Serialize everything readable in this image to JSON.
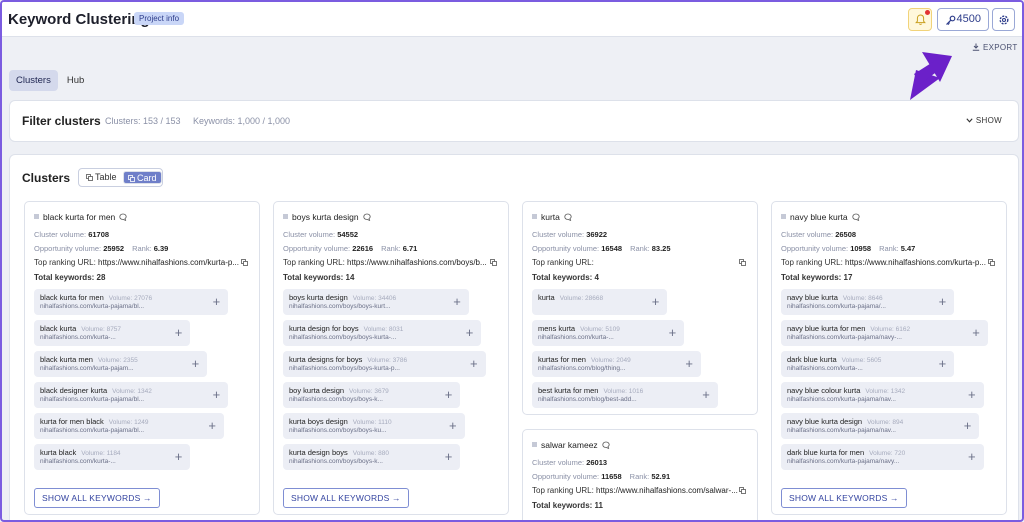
{
  "header": {
    "title": "Keyword Clustering",
    "badge": "Project info",
    "credits": "4500",
    "colors": {
      "accent": "#6f7fc9",
      "arrow": "#6b20c9",
      "border": "#7b5ce0"
    }
  },
  "toolbar": {
    "export_label": "EXPORT"
  },
  "tabs": [
    {
      "label": "Clusters",
      "active": true
    },
    {
      "label": "Hub",
      "active": false
    }
  ],
  "filter": {
    "title": "Filter clusters",
    "clusters_stat": "Clusters: 153 / 153",
    "keywords_stat": "Keywords: 1,000 / 1,000",
    "show_label": "SHOW"
  },
  "clusters": {
    "title": "Clusters",
    "view_table": "Table",
    "view_card": "Card",
    "labels": {
      "cluster_volume": "Cluster volume:",
      "opportunity_volume": "Opportunity volume:",
      "rank": "Rank:",
      "top_url": "Top ranking URL:",
      "total_keywords": "Total keywords:",
      "volume": "Volume:",
      "show_all": "SHOW ALL KEYWORDS"
    },
    "cards": [
      {
        "name": "black kurta for men",
        "cluster_volume": "61708",
        "opportunity_volume": "25952",
        "rank": "6.39",
        "top_url": "https://www.nihalfashions.com/kurta-p...",
        "total_keywords": "28",
        "keywords": [
          {
            "name": "black kurta for men",
            "volume": "27076",
            "url": "nihalfashions.com/kurta-pajama/bl..."
          },
          {
            "name": "black kurta",
            "volume": "8757",
            "url": "nihalfashions.com/kurta-..."
          },
          {
            "name": "black kurta men",
            "volume": "2355",
            "url": "nihalfashions.com/kurta-pajam..."
          },
          {
            "name": "black designer kurta",
            "volume": "1342",
            "url": "nihalfashions.com/kurta-pajama/bl..."
          },
          {
            "name": "kurta for men black",
            "volume": "1249",
            "url": "nihalfashions.com/kurta-pajama/bl..."
          },
          {
            "name": "kurta black",
            "volume": "1184",
            "url": "nihalfashions.com/kurta-..."
          }
        ],
        "show_all": true
      },
      {
        "name": "boys kurta design",
        "cluster_volume": "54552",
        "opportunity_volume": "22616",
        "rank": "6.71",
        "top_url": "https://www.nihalfashions.com/boys/b...",
        "total_keywords": "14",
        "keywords": [
          {
            "name": "boys kurta design",
            "volume": "34406",
            "url": "nihalfashions.com/boys/boys-kurt..."
          },
          {
            "name": "kurta design for boys",
            "volume": "8031",
            "url": "nihalfashions.com/boys/boys-kurta-..."
          },
          {
            "name": "kurta designs for boys",
            "volume": "3786",
            "url": "nihalfashions.com/boys/boys-kurta-p..."
          },
          {
            "name": "boy kurta design",
            "volume": "3679",
            "url": "nihalfashions.com/boys/boys-k..."
          },
          {
            "name": "kurta boys design",
            "volume": "1110",
            "url": "nihalfashions.com/boys/boys-ku..."
          },
          {
            "name": "kurta design boys",
            "volume": "880",
            "url": "nihalfashions.com/boys/boys-k..."
          }
        ],
        "show_all": true
      },
      {
        "name": "kurta",
        "cluster_volume": "36922",
        "opportunity_volume": "16548",
        "rank": "83.25",
        "top_url": "",
        "total_keywords": "4",
        "keywords": [
          {
            "name": "kurta",
            "volume": "28668",
            "url": ""
          },
          {
            "name": "mens kurta",
            "volume": "5109",
            "url": "nihalfashions.com/kurta-..."
          },
          {
            "name": "kurtas for men",
            "volume": "2049",
            "url": "nihalfashions.com/blog/thing..."
          },
          {
            "name": "best kurta for men",
            "volume": "1016",
            "url": "nihalfashions.com/blog/best-add..."
          }
        ],
        "show_all": false
      },
      {
        "name": "salwar kameez",
        "cluster_volume": "26013",
        "opportunity_volume": "11658",
        "rank": "52.91",
        "top_url": "https://www.nihalfashions.com/salwar-...",
        "total_keywords": "11",
        "keywords": [],
        "show_all": false
      },
      {
        "name": "navy blue kurta",
        "cluster_volume": "26508",
        "opportunity_volume": "10958",
        "rank": "5.47",
        "top_url": "https://www.nihalfashions.com/kurta-p...",
        "total_keywords": "17",
        "keywords": [
          {
            "name": "navy blue kurta",
            "volume": "8646",
            "url": "nihalfashions.com/kurta-pajama/..."
          },
          {
            "name": "navy blue kurta for men",
            "volume": "6162",
            "url": "nihalfashions.com/kurta-pajama/navy-..."
          },
          {
            "name": "dark blue kurta",
            "volume": "5605",
            "url": "nihalfashions.com/kurta-..."
          },
          {
            "name": "navy blue colour kurta",
            "volume": "1342",
            "url": "nihalfashions.com/kurta-pajama/nav..."
          },
          {
            "name": "navy blue kurta design",
            "volume": "894",
            "url": "nihalfashions.com/kurta-pajama/nav..."
          },
          {
            "name": "dark blue kurta for men",
            "volume": "720",
            "url": "nihalfashions.com/kurta-pajama/navy..."
          }
        ],
        "show_all": true
      }
    ]
  }
}
